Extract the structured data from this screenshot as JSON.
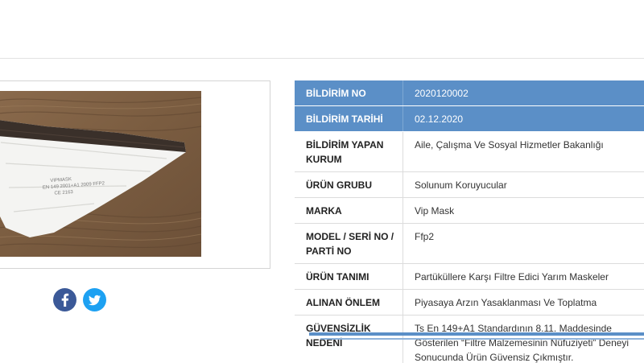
{
  "notification": {
    "rows": [
      {
        "label": "BİLDİRİM NO",
        "value": "2020120002",
        "highlight": true
      },
      {
        "label": "BİLDİRİM TARİHİ",
        "value": "02.12.2020",
        "highlight": true
      },
      {
        "label": "BİLDİRİM YAPAN KURUM",
        "value": "Aile, Çalışma Ve Sosyal Hizmetler Bakanlığı",
        "highlight": false
      },
      {
        "label": "ÜRÜN GRUBU",
        "value": "Solunum Koruyucular",
        "highlight": false
      },
      {
        "label": "MARKA",
        "value": "Vip Mask",
        "highlight": false
      },
      {
        "label": "MODEL / SERİ NO / PARTİ NO",
        "value": "Ffp2",
        "highlight": false
      },
      {
        "label": "ÜRÜN TANIMI",
        "value": "Partüküllere Karşı Filtre Edici Yarım Maskeler",
        "highlight": false
      },
      {
        "label": "ALINAN ÖNLEM",
        "value": "Piyasaya Arzın Yasaklanması Ve Toplatma",
        "highlight": false
      },
      {
        "label": "GÜVENSİZLİK NEDENİ",
        "value": "Ts En 149+A1 Standardının 8.11. Maddesinde Gösterilen “Filtre Malzemesinin Nüfuziyeti” Deneyi Sonucunda Ürün Güvensiz Çıkmıştır.",
        "highlight": false
      }
    ]
  },
  "product_image": {
    "print_text": [
      "VIPMASK",
      "EN 149 2001+A1 2009 FFP2",
      "CE 2163"
    ]
  },
  "social": {
    "items": [
      {
        "icon": "facebook-icon",
        "color": "#3b5998"
      },
      {
        "icon": "twitter-icon",
        "color": "#1da1f2"
      }
    ]
  },
  "colors": {
    "accent": "#5b8fc7",
    "border": "#dcdcdc"
  }
}
